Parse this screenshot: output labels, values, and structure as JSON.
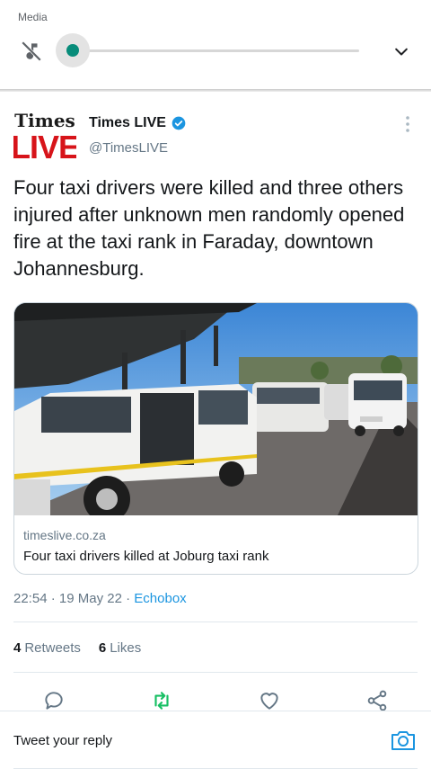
{
  "media_panel": {
    "label": "Media",
    "volume_level": 0.0
  },
  "tweet": {
    "account": {
      "name": "Times LIVE",
      "handle": "@TimesLIVE",
      "verified": true,
      "logo_top": "Times",
      "logo_bottom": "LIVE"
    },
    "text": "Four taxi drivers were killed and three others injured after unknown men randomly opened fire at the taxi rank in Faraday, downtown Johannesburg.",
    "card": {
      "domain": "timeslive.co.za",
      "title": "Four taxi drivers killed at Joburg taxi rank"
    },
    "meta": {
      "time": "22:54",
      "date": "19 May 22",
      "source": "Echobox",
      "sep": " · "
    },
    "stats": {
      "retweets_count": "4",
      "retweets_label": "Retweets",
      "likes_count": "6",
      "likes_label": "Likes"
    }
  },
  "reply": {
    "placeholder": "Tweet your reply"
  },
  "colors": {
    "accent": "#1b95e0",
    "retweet_green": "#17bf63",
    "slider_thumb": "#078c7a",
    "logo_red": "#d7141a"
  }
}
